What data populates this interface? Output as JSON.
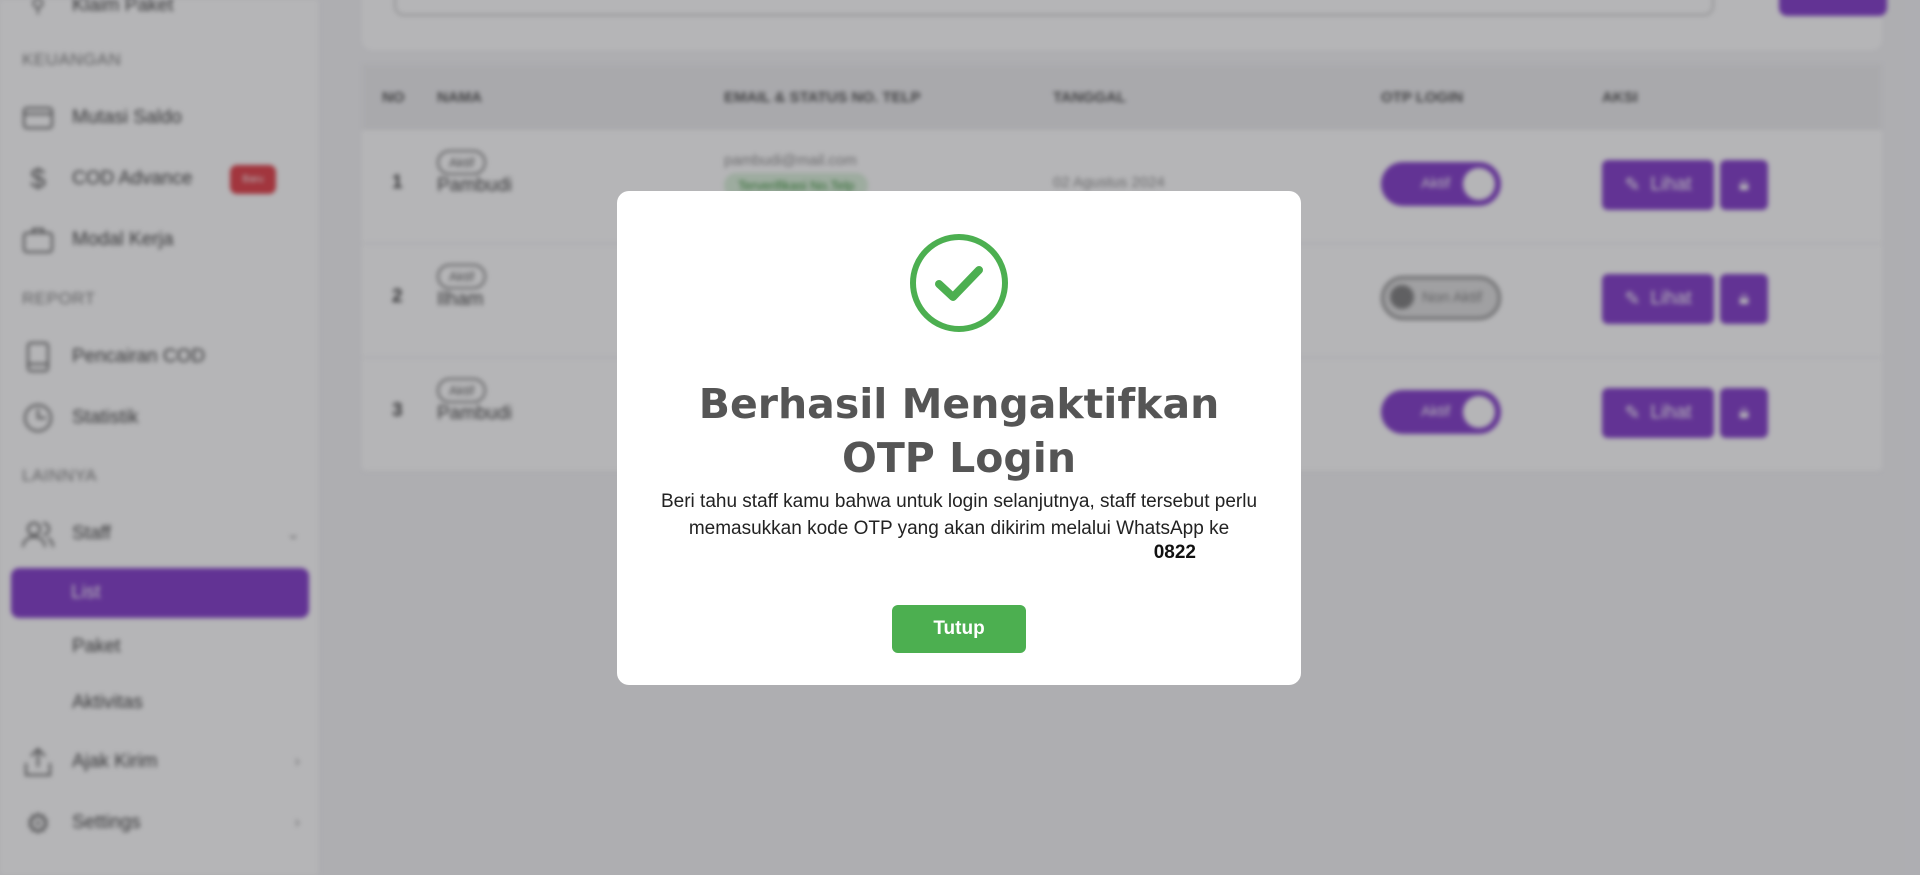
{
  "sidebar": {
    "top_item": "Klaim Paket",
    "sections": {
      "keuangan": "KEUANGAN",
      "report": "REPORT",
      "lainnya": "LAINNYA"
    },
    "items": {
      "mutasi_saldo": "Mutasi Saldo",
      "cod_advance": "COD Advance",
      "cod_advance_badge": "Baru",
      "modal_kerja": "Modal Kerja",
      "pencairan_cod": "Pencairan COD",
      "statistik": "Statistik",
      "staff": "Staff",
      "staff_list": "List",
      "staff_paket": "Paket",
      "staff_aktivitas": "Aktivitas",
      "ajak_kirim": "Ajak Kirim",
      "settings": "Settings"
    }
  },
  "table": {
    "headers": {
      "no": "NO",
      "nama": "NAMA",
      "email": "EMAIL & STATUS NO. TELP",
      "tanggal": "TANGGAL",
      "otp": "OTP LOGIN",
      "aksi": "AKSI"
    },
    "rows": [
      {
        "no": "1",
        "status": "Aktif",
        "name": "Pambudi",
        "email": "pambudi@mail.com",
        "verif": "Terverifikasi No.Telp",
        "date": "02 Agustus 2024",
        "otp_label": "Aktif",
        "otp_on": true
      },
      {
        "no": "2",
        "status": "Aktif",
        "name": "Ilham",
        "email": "",
        "verif": "",
        "date": "",
        "otp_label": "Non Aktif",
        "otp_on": false
      },
      {
        "no": "3",
        "status": "Aktif",
        "name": "Pambudi",
        "email": "",
        "verif": "",
        "date": "",
        "otp_label": "Aktif",
        "otp_on": true
      }
    ],
    "lihat_label": "Lihat"
  },
  "modal": {
    "title": "Berhasil Mengaktifkan OTP Login",
    "message_line1": "Beri tahu staff kamu bahwa untuk login selanjutnya, staff tersebut perlu",
    "message_line2": "memasukkan kode OTP yang akan dikirim melalui WhatsApp ke",
    "phone": "0822",
    "close_label": "Tutup"
  },
  "colors": {
    "primary": "#7a2ec7",
    "success": "#4caf50",
    "badge": "#e0323c"
  }
}
